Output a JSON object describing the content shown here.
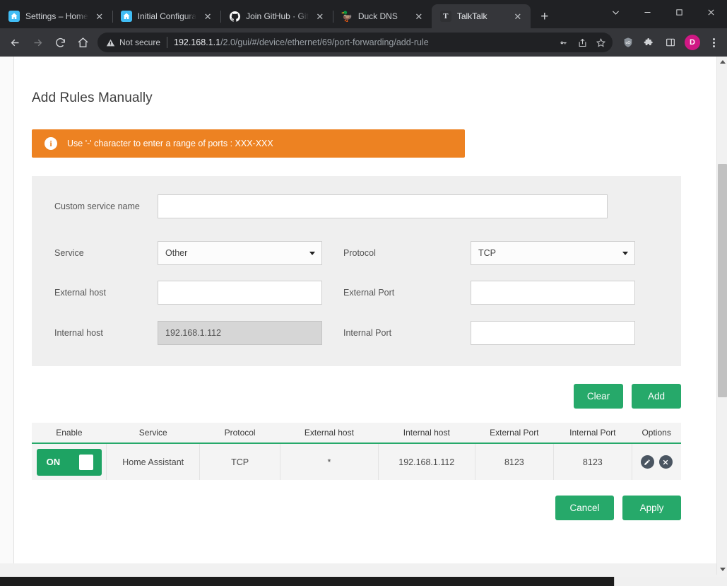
{
  "browser": {
    "tabs": [
      {
        "title": "Settings – Home",
        "favicon": "home-assistant-icon",
        "active": false
      },
      {
        "title": "Initial Configura",
        "favicon": "home-assistant-icon",
        "active": false
      },
      {
        "title": "Join GitHub · Git",
        "favicon": "github-icon",
        "active": false
      },
      {
        "title": "Duck DNS",
        "favicon": "duck-icon",
        "active": false
      },
      {
        "title": "TalkTalk",
        "favicon": "talktalk-icon",
        "active": true
      }
    ],
    "new_tab_label": "+",
    "close_label": "✕",
    "window_controls": [
      "tab-search",
      "minimize",
      "maximize",
      "close"
    ],
    "omnibox": {
      "security_label": "Not secure",
      "url_host": "192.168.1.1",
      "url_path": "/2.0/gui/#/device/ethernet/69/port-forwarding/add-rule"
    },
    "profile_initial": "D"
  },
  "page": {
    "title": "Add Rules Manually",
    "alert": {
      "text": "Use '-' character to enter a range of ports : XXX-XXX",
      "icon": "info-icon",
      "color": "#ed8222"
    },
    "form": {
      "custom_service_name": {
        "label": "Custom service name",
        "value": "",
        "placeholder": ""
      },
      "service": {
        "label": "Service",
        "value": "Other"
      },
      "protocol": {
        "label": "Protocol",
        "value": "TCP"
      },
      "external_host": {
        "label": "External host",
        "value": "",
        "placeholder": ""
      },
      "external_port": {
        "label": "External Port",
        "value": "",
        "placeholder": ""
      },
      "internal_host": {
        "label": "Internal host",
        "value": "192.168.1.112",
        "disabled": true
      },
      "internal_port": {
        "label": "Internal Port",
        "value": "",
        "placeholder": ""
      }
    },
    "form_buttons": {
      "clear": "Clear",
      "add": "Add"
    },
    "table": {
      "headers": [
        "Enable",
        "Service",
        "Protocol",
        "External host",
        "Internal host",
        "External Port",
        "Internal Port",
        "Options"
      ],
      "rows": [
        {
          "enable": "ON",
          "service": "Home Assistant",
          "protocol": "TCP",
          "external_host": "*",
          "internal_host": "192.168.1.112",
          "external_port": "8123",
          "internal_port": "8123",
          "options": [
            "edit-icon",
            "delete-icon"
          ]
        }
      ]
    },
    "footer_buttons": {
      "cancel": "Cancel",
      "apply": "Apply"
    },
    "accent_green": "#26a96a"
  }
}
